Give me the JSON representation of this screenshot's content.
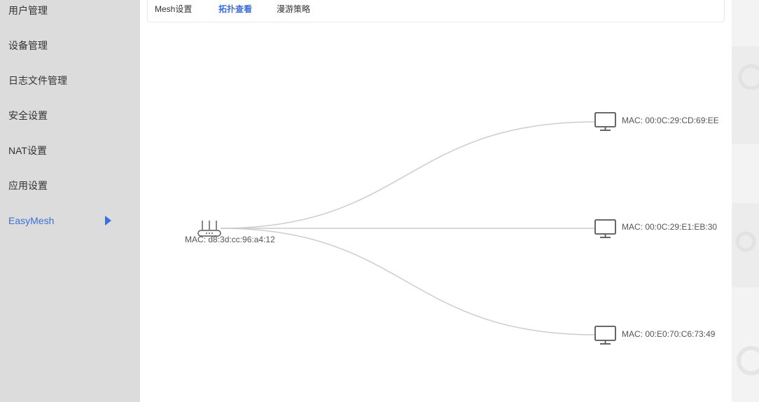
{
  "sidebar": {
    "items": [
      {
        "label": "用户管理"
      },
      {
        "label": "设备管理"
      },
      {
        "label": "日志文件管理"
      },
      {
        "label": "安全设置"
      },
      {
        "label": "NAT设置"
      },
      {
        "label": "应用设置"
      },
      {
        "label": "EasyMesh",
        "active": true
      }
    ]
  },
  "tabs": [
    {
      "label": "Mesh设置"
    },
    {
      "label": "拓扑查看",
      "active": true
    },
    {
      "label": "漫游策略"
    }
  ],
  "topology": {
    "root": {
      "icon": "router-icon",
      "label": "MAC: d8:3d:cc:96:a4:12"
    },
    "children": [
      {
        "icon": "monitor-icon",
        "label": "MAC: 00:0C:29:CD:69:EE"
      },
      {
        "icon": "monitor-icon",
        "label": "MAC: 00:0C:29:E1:EB:30"
      },
      {
        "icon": "monitor-icon",
        "label": "MAC: 00:E0:70:C6:73:49"
      }
    ]
  },
  "colors": {
    "accent": "#3d6fd6",
    "sidebar_bg": "#dcdcdc",
    "link_line": "#cccccc",
    "icon": "#555555"
  }
}
